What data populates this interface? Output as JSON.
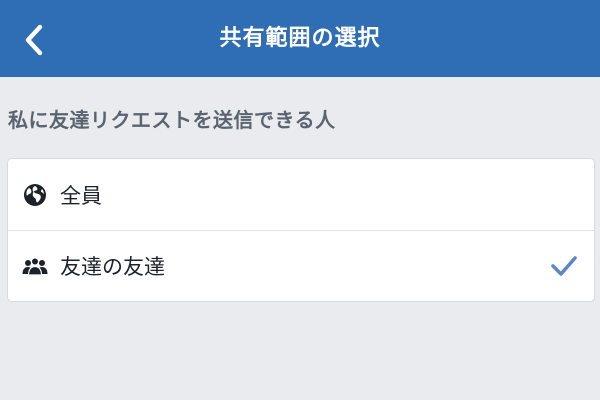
{
  "header": {
    "title": "共有範囲の選択",
    "back_icon": "chevron-left-icon",
    "background": "#2f6db4"
  },
  "section": {
    "label": "私に友達リクエストを送信できる人"
  },
  "options": [
    {
      "label": "全員",
      "icon": "globe-icon",
      "selected": false
    },
    {
      "label": "友達の友達",
      "icon": "people-icon",
      "selected": true
    }
  ],
  "colors": {
    "accent": "#2f6db4",
    "check": "#5d86c7",
    "background": "#e9ebee"
  }
}
